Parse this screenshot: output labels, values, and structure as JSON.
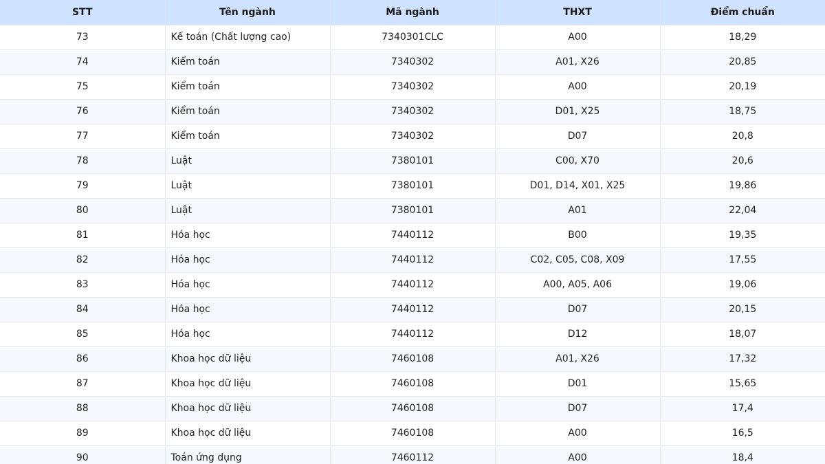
{
  "table": {
    "headers": [
      "STT",
      "Tên ngành",
      "Mã ngành",
      "THXT",
      "Điểm chuẩn"
    ],
    "rows": [
      [
        "73",
        "Kế toán (Chất lượng cao)",
        "7340301CLC",
        "A00",
        "18,29"
      ],
      [
        "74",
        "Kiểm toán",
        "7340302",
        "A01, X26",
        "20,85"
      ],
      [
        "75",
        "Kiểm toán",
        "7340302",
        "A00",
        "20,19"
      ],
      [
        "76",
        "Kiểm toán",
        "7340302",
        "D01, X25",
        "18,75"
      ],
      [
        "77",
        "Kiểm toán",
        "7340302",
        "D07",
        "20,8"
      ],
      [
        "78",
        "Luật",
        "7380101",
        "C00, X70",
        "20,6"
      ],
      [
        "79",
        "Luật",
        "7380101",
        "D01, D14, X01, X25",
        "19,86"
      ],
      [
        "80",
        "Luật",
        "7380101",
        "A01",
        "22,04"
      ],
      [
        "81",
        "Hóa học",
        "7440112",
        "B00",
        "19,35"
      ],
      [
        "82",
        "Hóa học",
        "7440112",
        "C02, C05, C08, X09",
        "17,55"
      ],
      [
        "83",
        "Hóa học",
        "7440112",
        "A00, A05, A06",
        "19,06"
      ],
      [
        "84",
        "Hóa học",
        "7440112",
        "D07",
        "20,15"
      ],
      [
        "85",
        "Hóa học",
        "7440112",
        "D12",
        "18,07"
      ],
      [
        "86",
        "Khoa học dữ liệu",
        "7460108",
        "A01, X26",
        "17,32"
      ],
      [
        "87",
        "Khoa học dữ liệu",
        "7460108",
        "D01",
        "15,65"
      ],
      [
        "88",
        "Khoa học dữ liệu",
        "7460108",
        "D07",
        "17,4"
      ],
      [
        "89",
        "Khoa học dữ liệu",
        "7460108",
        "A00",
        "16,5"
      ],
      [
        "90",
        "Toán ứng dụng",
        "7460112",
        "A00",
        "18,4"
      ]
    ]
  },
  "colors": {
    "header_bg": "#cfe2ff",
    "stripe_bg": "#f5f8fd",
    "border": "#e3e8f0"
  }
}
